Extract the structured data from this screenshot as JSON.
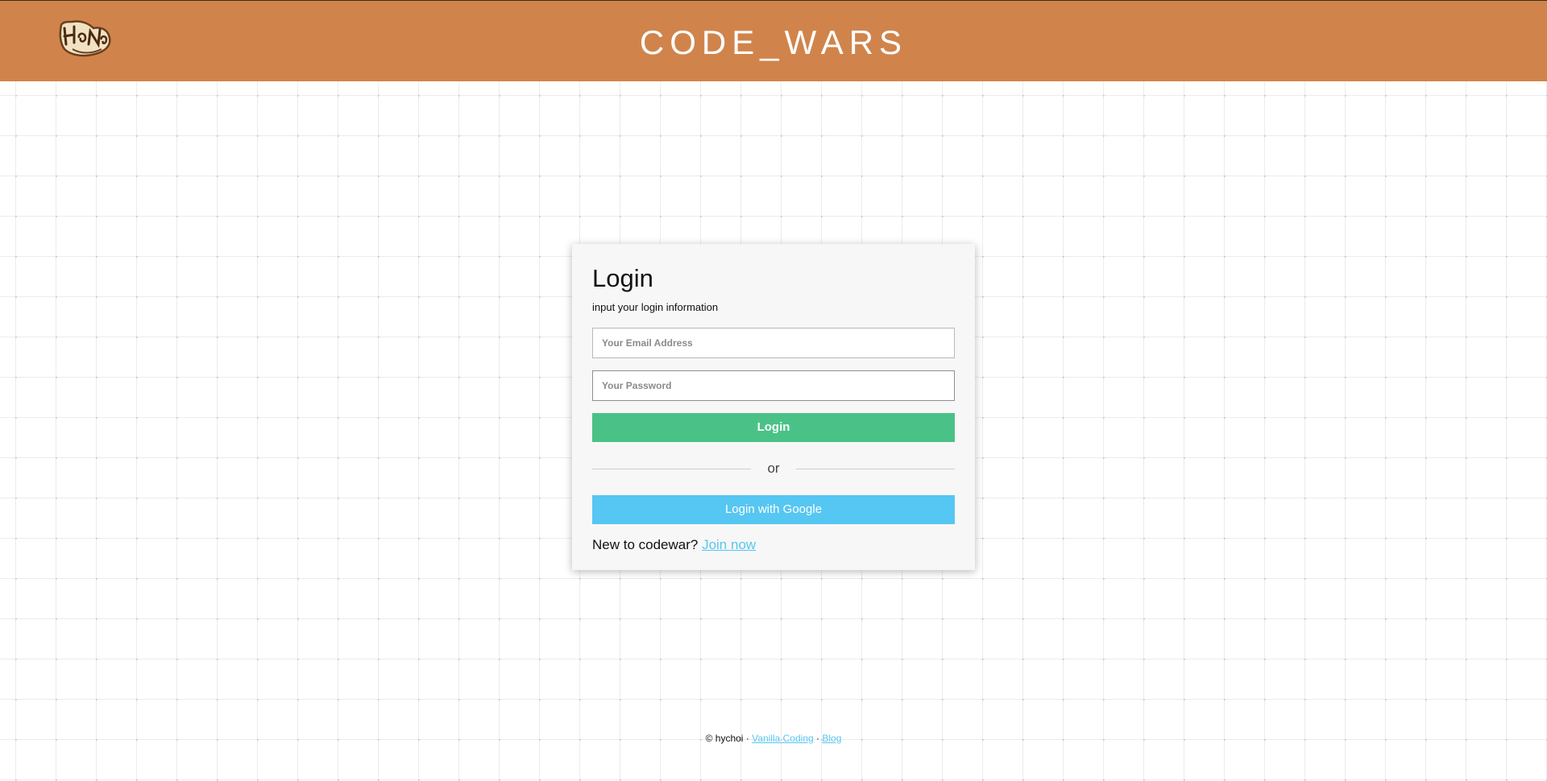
{
  "header": {
    "title": "CODE_WARS",
    "logo_icon": "hanna-logo-icon",
    "background_color": "#d0844b"
  },
  "login_card": {
    "title": "Login",
    "subtitle": "input your login information",
    "email_placeholder": "Your Email Address",
    "password_placeholder": "Your Password",
    "login_button": "Login",
    "divider_text": "or",
    "google_button": "Login with Google",
    "signup_prompt": "New to codewar?",
    "signup_link": "Join now"
  },
  "footer": {
    "copyright": "© hychoi",
    "separator": "·",
    "links": [
      "Vanilla Coding",
      "Blog"
    ]
  },
  "colors": {
    "accent_green": "#4ac287",
    "accent_blue": "#56c6f2",
    "link": "#56c6f2"
  }
}
